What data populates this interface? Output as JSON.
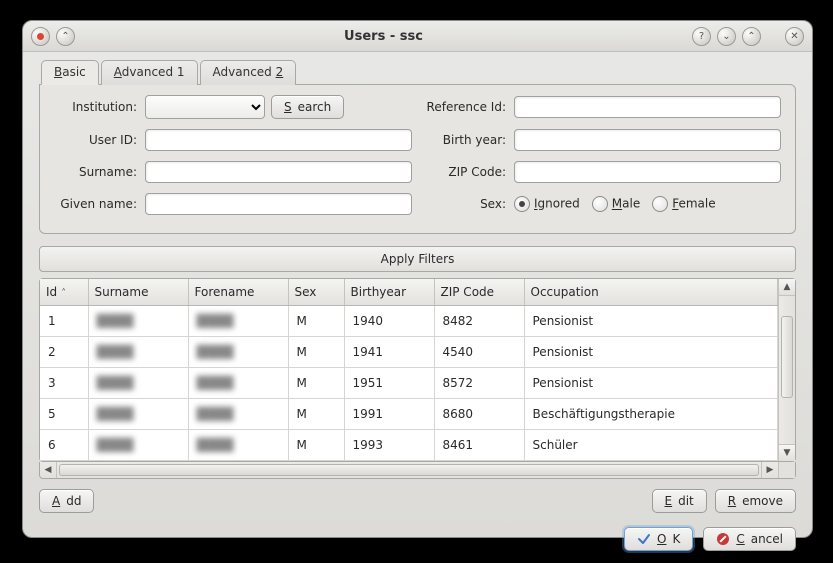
{
  "window": {
    "title": "Users - ssc"
  },
  "tabs": [
    {
      "label_pre": "",
      "u": "B",
      "label_post": "asic",
      "active": true
    },
    {
      "label_pre": "",
      "u": "A",
      "label_post": "dvanced 1",
      "active": false
    },
    {
      "label_pre": "Advanced ",
      "u": "2",
      "label_post": "",
      "active": false
    }
  ],
  "form": {
    "institution_label": "Institution:",
    "search_u": "S",
    "search_post": "earch",
    "userid_label": "User ID:",
    "surname_label": "Surname:",
    "givenname_label": "Given name:",
    "reference_label": "Reference Id:",
    "birthyear_label": "Birth year:",
    "zip_label": "ZIP Code:",
    "sex_label": "Sex:",
    "sex_options": [
      {
        "u": "I",
        "post": "gnored",
        "checked": true
      },
      {
        "u": "M",
        "post": "ale",
        "checked": false
      },
      {
        "u": "F",
        "post": "emale",
        "checked": false
      }
    ]
  },
  "apply_label": "Apply Filters",
  "columns": [
    "Id",
    "Surname",
    "Forename",
    "Sex",
    "Birthyear",
    "ZIP Code",
    "Occupation"
  ],
  "rows": [
    {
      "id": "1",
      "surname": "████",
      "forename": "████",
      "sex": "M",
      "birthyear": "1940",
      "zip": "8482",
      "occupation": "Pensionist"
    },
    {
      "id": "2",
      "surname": "████",
      "forename": "████",
      "sex": "M",
      "birthyear": "1941",
      "zip": "4540",
      "occupation": "Pensionist"
    },
    {
      "id": "3",
      "surname": "████",
      "forename": "████",
      "sex": "M",
      "birthyear": "1951",
      "zip": "8572",
      "occupation": "Pensionist"
    },
    {
      "id": "5",
      "surname": "████",
      "forename": "████",
      "sex": "M",
      "birthyear": "1991",
      "zip": "8680",
      "occupation": "Beschäftigungstherapie"
    },
    {
      "id": "6",
      "surname": "████",
      "forename": "████",
      "sex": "M",
      "birthyear": "1993",
      "zip": "8461",
      "occupation": "Schüler"
    }
  ],
  "buttons": {
    "add_u": "A",
    "add_post": "dd",
    "edit_u": "E",
    "edit_post": "dit",
    "remove_u": "R",
    "remove_post": "emove",
    "ok_u": "O",
    "ok_post": "K",
    "cancel_u": "C",
    "cancel_post": "ancel"
  }
}
